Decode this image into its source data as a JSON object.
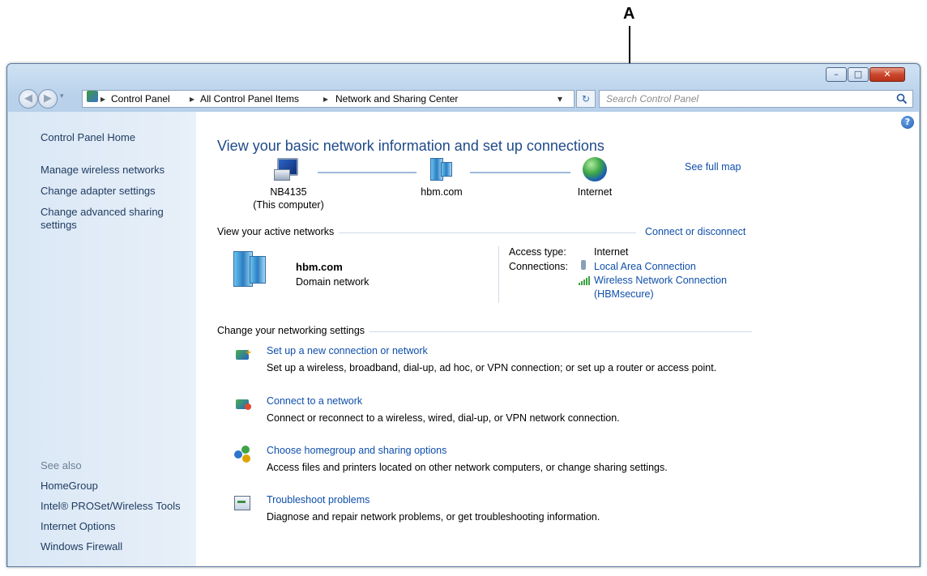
{
  "callout": {
    "letter": "A"
  },
  "window": {
    "controls": {
      "minimize": "–",
      "maximize": "□",
      "close": "✕"
    }
  },
  "address_bar": {
    "breadcrumb": [
      "Control Panel",
      "All Control Panel Items",
      "Network and Sharing Center"
    ],
    "separator": "▸",
    "dropdown": "▾",
    "search_placeholder": "Search Control Panel"
  },
  "sidebar": {
    "home": "Control Panel Home",
    "tasks": [
      "Manage wireless networks",
      "Change adapter settings",
      "Change advanced sharing",
      "settings"
    ],
    "see_also_title": "See also",
    "see_also": [
      "HomeGroup",
      "Intel® PROSet/Wireless Tools",
      "Internet Options",
      "Windows Firewall"
    ]
  },
  "main": {
    "title": "View your basic network information and set up connections",
    "see_full_map": "See full map",
    "map": {
      "computer": "NB4135",
      "computer_sub": "(This computer)",
      "domain": "hbm.com",
      "internet": "Internet"
    },
    "active_networks": {
      "heading": "View your active networks",
      "connect_link": "Connect or disconnect",
      "network_name": "hbm.com",
      "network_type": "Domain network",
      "access_type_label": "Access type:",
      "access_type_value": "Internet",
      "connections_label": "Connections:",
      "connection_1": "Local Area Connection",
      "connection_2": "Wireless Network Connection",
      "connection_2_ssid": "(HBMsecure)"
    },
    "settings": {
      "heading": "Change your networking settings",
      "items": [
        {
          "title": "Set up a new connection or network",
          "desc": "Set up a wireless, broadband, dial-up, ad hoc, or VPN connection; or set up a router or access point."
        },
        {
          "title": "Connect to a network",
          "desc": "Connect or reconnect to a wireless, wired, dial-up, or VPN network connection."
        },
        {
          "title": "Choose homegroup and sharing options",
          "desc": "Access files and printers located on other network computers, or change sharing settings."
        },
        {
          "title": "Troubleshoot problems",
          "desc": "Diagnose and repair network problems, or get troubleshooting information."
        }
      ]
    }
  }
}
